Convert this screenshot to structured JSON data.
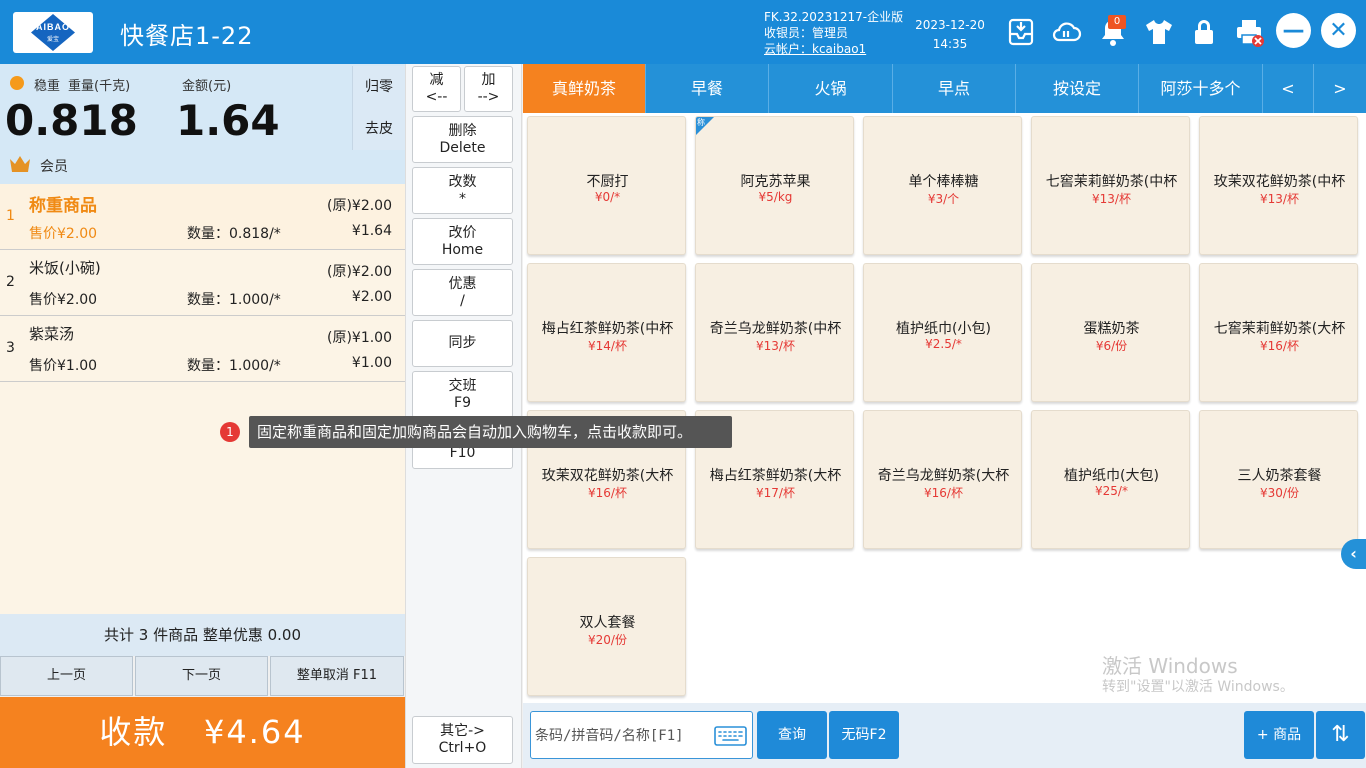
{
  "app": {
    "logo_text": "AIBAO",
    "logo_sub": "爱宝",
    "store_name": "快餐店1-22",
    "version": "FK.32.20231217-企业版",
    "cashier": "收银员：管理员",
    "cloud_account": "云帐户：kcaibao1",
    "date": "2023-12-20",
    "time": "14:35",
    "notification_count": "0"
  },
  "scale": {
    "stable_label": "稳重",
    "weight_label": "重量(千克)",
    "amount_label": "金额(元)",
    "weight": "0.818",
    "amount": "1.64",
    "zero_label": "归零",
    "tare_label": "去皮",
    "member_label": "会员"
  },
  "cart": {
    "items": [
      {
        "idx": "1",
        "name": "称重商品",
        "orig": "(原)¥2.00",
        "price": "售价¥2.00",
        "qty": "数量：0.818/*",
        "amount": "¥1.64"
      },
      {
        "idx": "2",
        "name": "米饭(小碗)",
        "orig": "(原)¥2.00",
        "price": "售价¥2.00",
        "qty": "数量：1.000/*",
        "amount": "¥2.00"
      },
      {
        "idx": "3",
        "name": "紫菜汤",
        "orig": "(原)¥1.00",
        "price": "售价¥1.00",
        "qty": "数量：1.000/*",
        "amount": "¥1.00"
      }
    ],
    "summary": "共计 3 件商品 整单优惠 0.00",
    "prev_page": "上一页",
    "next_page": "下一页",
    "cancel_order": "整单取消 F11",
    "pay_label": "收款",
    "pay_amount": "¥4.64"
  },
  "actions": {
    "minus": {
      "l1": "减",
      "l2": "<--"
    },
    "plus": {
      "l1": "加",
      "l2": "-->"
    },
    "delete": {
      "l1": "删除",
      "l2": "Delete"
    },
    "change_qty": {
      "l1": "改数",
      "l2": "*"
    },
    "change_price": {
      "l1": "改价",
      "l2": "Home"
    },
    "discount": {
      "l1": "优惠",
      "l2": "/"
    },
    "sync": {
      "l1": "同步"
    },
    "shift": {
      "l1": "交班",
      "l2": "F9"
    },
    "f10": {
      "l2": "F10"
    },
    "other": {
      "l1": "其它->",
      "l2": "Ctrl+O"
    }
  },
  "tooltip": {
    "num": "1",
    "text": "固定称重商品和固定加购商品会自动加入购物车，点击收款即可。"
  },
  "tabs": [
    "真鲜奶茶",
    "早餐",
    "火锅",
    "早点",
    "按设定",
    "阿莎十多个"
  ],
  "tab_prev": "<",
  "tab_next": ">",
  "weighed_tag": "称",
  "products": [
    {
      "name": "不厨打",
      "price": "¥0/*"
    },
    {
      "name": "阿克苏苹果",
      "price": "¥5/kg"
    },
    {
      "name": "单个棒棒糖",
      "price": "¥3/个"
    },
    {
      "name": "七窖茉莉鲜奶茶(中杯",
      "price": "¥13/杯"
    },
    {
      "name": "玫茉双花鲜奶茶(中杯",
      "price": "¥13/杯"
    },
    {
      "name": "梅占红茶鲜奶茶(中杯",
      "price": "¥14/杯"
    },
    {
      "name": "奇兰乌龙鲜奶茶(中杯",
      "price": "¥13/杯"
    },
    {
      "name": "植护纸巾(小包)",
      "price": "¥2.5/*"
    },
    {
      "name": "蛋糕奶茶",
      "price": "¥6/份"
    },
    {
      "name": "七窖茉莉鲜奶茶(大杯",
      "price": "¥16/杯"
    },
    {
      "name": "玫茉双花鲜奶茶(大杯",
      "price": "¥16/杯"
    },
    {
      "name": "梅占红茶鲜奶茶(大杯",
      "price": "¥17/杯"
    },
    {
      "name": "奇兰乌龙鲜奶茶(大杯",
      "price": "¥16/杯"
    },
    {
      "name": "植护纸巾(大包)",
      "price": "¥25/*"
    },
    {
      "name": "三人奶茶套餐",
      "price": "¥30/份"
    },
    {
      "name": "双人套餐",
      "price": "¥20/份"
    }
  ],
  "watermark": {
    "line1": "激活 Windows",
    "line2": "转到\"设置\"以激活 Windows。"
  },
  "bottom": {
    "search_placeholder": "条码/拼音码/名称[F1]",
    "query": "查询",
    "no_code": "无码F2",
    "add_product": "+ 商品"
  },
  "colors": {
    "primary": "#1a8ad8",
    "accent": "#f5821f",
    "price": "#e53935"
  }
}
